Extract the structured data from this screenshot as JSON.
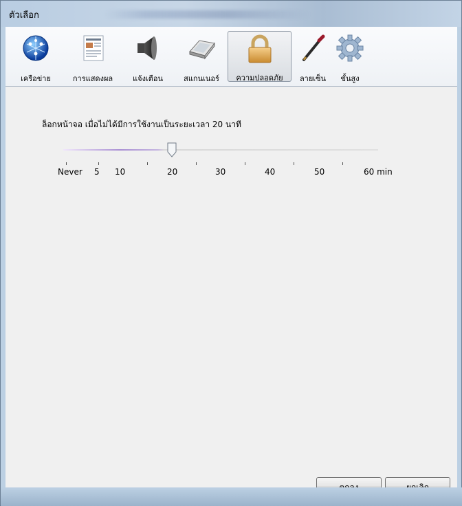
{
  "window": {
    "title": "ตัวเลือก"
  },
  "toolbar": {
    "items": [
      {
        "label": "เครือข่าย",
        "icon": "network-globe-icon"
      },
      {
        "label": "การแสดงผล",
        "icon": "display-document-icon"
      },
      {
        "label": "แจ้งเตือน",
        "icon": "speaker-icon"
      },
      {
        "label": "สแกนเนอร์",
        "icon": "scanner-icon"
      },
      {
        "label": "ความปลอดภัย",
        "icon": "padlock-icon",
        "active": true
      },
      {
        "label": "ลายเซ็น",
        "icon": "pen-icon"
      },
      {
        "label": "ขั้นสูง",
        "icon": "gear-icon"
      }
    ]
  },
  "security": {
    "lock_text": "ล็อกหน้าจอ เมื่อไม่ได้มีการใช้งานเป็นระยะเวลา 20 นาที",
    "slider": {
      "value": 20,
      "unit": "min",
      "labels": [
        "Never",
        "5",
        "10",
        "20",
        "30",
        "40",
        "50",
        "60 min"
      ]
    }
  },
  "buttons": {
    "ok": "ตกลง",
    "cancel": "ยกเลิก"
  },
  "colors": {
    "active_track": "#a98fd3",
    "window_frame": "#bcd0e3"
  }
}
